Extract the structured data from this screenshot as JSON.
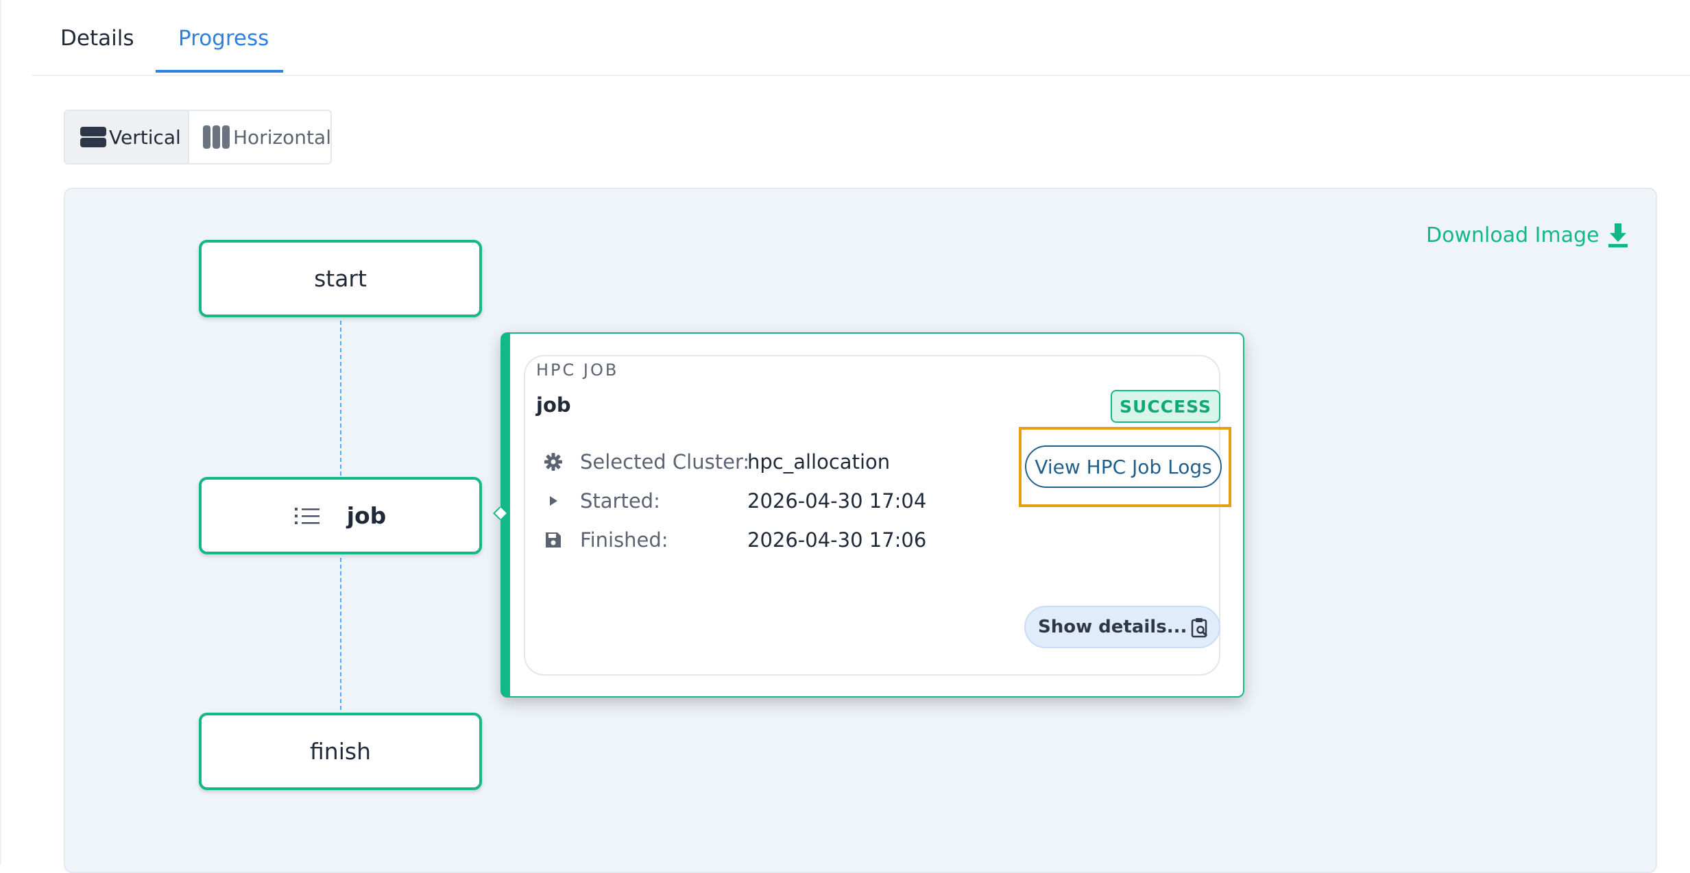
{
  "tabs": [
    {
      "label": "Details",
      "active": false
    },
    {
      "label": "Progress",
      "active": true
    }
  ],
  "orientation": {
    "vertical_label": "Vertical",
    "horizontal_label": "Horizontal",
    "selected": "Vertical"
  },
  "canvas": {
    "download_label": "Download Image"
  },
  "nodes": {
    "start": "start",
    "job": "job",
    "finish": "finish"
  },
  "popover": {
    "kind": "HPC JOB",
    "name": "job",
    "status": "SUCCESS",
    "logs_button": "View HPC Job Logs",
    "rows": [
      {
        "icon": "gear-icon",
        "label": "Selected Cluster:",
        "value": "hpc_allocation"
      },
      {
        "icon": "play-icon",
        "label": "Started:",
        "value": "2026-04-30 17:04"
      },
      {
        "icon": "floppy-disk-icon",
        "label": "Finished:",
        "value": "2026-04-30 17:06"
      }
    ],
    "details_button": "Show details..."
  },
  "colors": {
    "accent_green": "#12b886",
    "accent_blue": "#2f7fe0",
    "link_blue": "#1f5f8b",
    "highlight": "#e5a00d"
  }
}
